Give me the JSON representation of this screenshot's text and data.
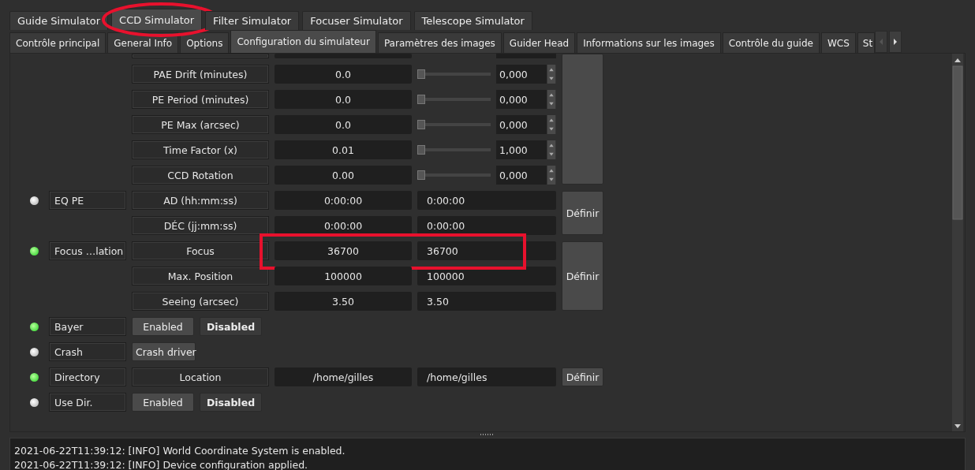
{
  "tabs": [
    {
      "label": "Guide Simulator",
      "selected": false,
      "circled": false
    },
    {
      "label": "CCD Simulator",
      "selected": true,
      "circled": true
    },
    {
      "label": "Filter Simulator",
      "selected": false,
      "circled": false
    },
    {
      "label": "Focuser Simulator",
      "selected": false,
      "circled": false
    },
    {
      "label": "Telescope Simulator",
      "selected": false,
      "circled": false
    }
  ],
  "subtabs": [
    {
      "label": "Contrôle principal",
      "selected": false
    },
    {
      "label": "General Info",
      "selected": false
    },
    {
      "label": "Options",
      "selected": false
    },
    {
      "label": "Configuration du simulateur",
      "selected": true
    },
    {
      "label": "Paramètres des images",
      "selected": false
    },
    {
      "label": "Guider Head",
      "selected": false
    },
    {
      "label": "Informations sur les images",
      "selected": false
    },
    {
      "label": "Contrôle du guide",
      "selected": false
    },
    {
      "label": "WCS",
      "selected": false
    },
    {
      "label": "St",
      "selected": false
    }
  ],
  "properties": [
    {
      "kind": "number",
      "rows": [
        {
          "label": "PAE Drift (minutes)",
          "value": "0.0",
          "level": 0,
          "spin": "0,000"
        },
        {
          "label": "PE Period (minutes)",
          "value": "0.0",
          "level": 0,
          "spin": "0,000"
        },
        {
          "label": "PE Max (arcsec)",
          "value": "0.0",
          "level": 0,
          "spin": "0,000"
        },
        {
          "label": "Time Factor (x)",
          "value": "0.01",
          "level": 0,
          "spin": "1,000"
        },
        {
          "label": "CCD Rotation",
          "value": "0.00",
          "level": 0,
          "spin": "0,000"
        }
      ]
    },
    {
      "kind": "text",
      "on": false,
      "name": "EQ PE",
      "button": "Définir",
      "rows": [
        {
          "label": "AD (hh:mm:ss)",
          "value": "0:00:00",
          "target": "0:00:00"
        },
        {
          "label": "DÉC (jj:mm:ss)",
          "value": "0:00:00",
          "target": "0:00:00"
        }
      ]
    },
    {
      "kind": "text",
      "on": true,
      "name": "Focus …lation",
      "button": "Définir",
      "rows": [
        {
          "label": "Focus",
          "value": "36700",
          "target": "36700",
          "highlighted": true
        },
        {
          "label": "Max. Position",
          "value": "100000",
          "target": "100000"
        },
        {
          "label": "Seeing (arcsec)",
          "value": "3.50",
          "target": "3.50"
        }
      ]
    },
    {
      "kind": "switch",
      "on": true,
      "name": "Bayer",
      "buttons": [
        {
          "label": "Enabled",
          "selected": false
        },
        {
          "label": "Disabled",
          "selected": true
        }
      ]
    },
    {
      "kind": "switch",
      "on": false,
      "name": "Crash",
      "buttons": [
        {
          "label": "Crash driver",
          "selected": false
        }
      ]
    },
    {
      "kind": "text",
      "on": true,
      "name": "Directory",
      "button": "Définir",
      "rows": [
        {
          "label": "Location",
          "value": "/home/gilles",
          "target": "/home/gilles"
        }
      ]
    },
    {
      "kind": "switch",
      "on": false,
      "name": "Use Dir.",
      "buttons": [
        {
          "label": "Enabled",
          "selected": false
        },
        {
          "label": "Disabled",
          "selected": true
        }
      ]
    }
  ],
  "log": [
    "2021-06-22T11:39:12: [INFO] World Coordinate System is enabled.",
    "2021-06-22T11:39:12: [INFO] Device configuration applied."
  ]
}
